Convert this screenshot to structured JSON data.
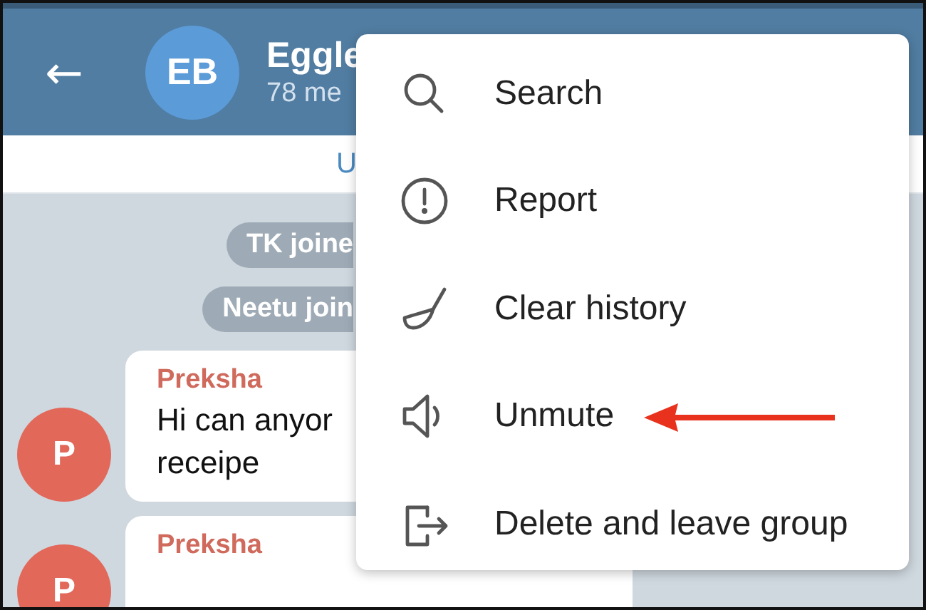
{
  "header": {
    "back": "←",
    "avatar": "EB",
    "title": "Eggle",
    "subtitle": "78 me"
  },
  "pinned": {
    "text": "U"
  },
  "service_messages": [
    "TK joine",
    "Neetu join"
  ],
  "messages": [
    {
      "avatar": "P",
      "sender": "Preksha",
      "lines": [
        "Hi can anyor",
        "receipe"
      ]
    },
    {
      "avatar": "P",
      "sender": "Preksha"
    }
  ],
  "menu": [
    {
      "kind": "search",
      "label": "Search",
      "annotated": false
    },
    {
      "kind": "report",
      "label": "Report",
      "annotated": false
    },
    {
      "kind": "clear",
      "label": "Clear history",
      "annotated": false
    },
    {
      "kind": "mute",
      "label": "Unmute",
      "annotated": true
    },
    {
      "kind": "leave",
      "label": "Delete and leave group",
      "annotated": false
    }
  ]
}
